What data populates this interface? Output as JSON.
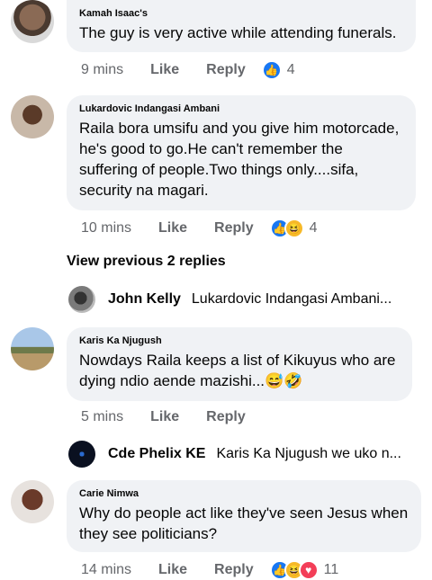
{
  "comments": [
    {
      "author": "Kamah Isaac's",
      "text": "The guy is very active while attending funerals.",
      "time": "9 mins",
      "like_label": "Like",
      "reply_label": "Reply",
      "reaction_count": "4"
    },
    {
      "author": "Lukardovic Indangasi Ambani",
      "text": "Raila bora umsifu and you give him motorcade, he's good to go.He can't remember the suffering of people.Two things only....sifa, security na magari.",
      "time": "10 mins",
      "like_label": "Like",
      "reply_label": "Reply",
      "reaction_count": "4"
    },
    {
      "author": "Karis Ka Njugush",
      "text": "Nowdays Raila keeps a list of Kikuyus who are dying ndio aende mazishi...😅🤣",
      "time": "5 mins",
      "like_label": "Like",
      "reply_label": "Reply"
    },
    {
      "author": "Carie Nimwa",
      "text": "Why do people act like they've seen Jesus when they see politicians?",
      "time": "14 mins",
      "like_label": "Like",
      "reply_label": "Reply",
      "reaction_count": "11"
    }
  ],
  "view_previous": "View previous 2 replies",
  "replies": [
    {
      "name": "John Kelly",
      "snippet": "Lukardovic Indangasi Ambani..."
    },
    {
      "name": "Cde Phelix KE",
      "snippet": "Karis Ka Njugush we uko n..."
    }
  ],
  "colors": {
    "like_blue": "#1877f2",
    "bubble": "#f0f2f5",
    "meta": "#65676b"
  }
}
